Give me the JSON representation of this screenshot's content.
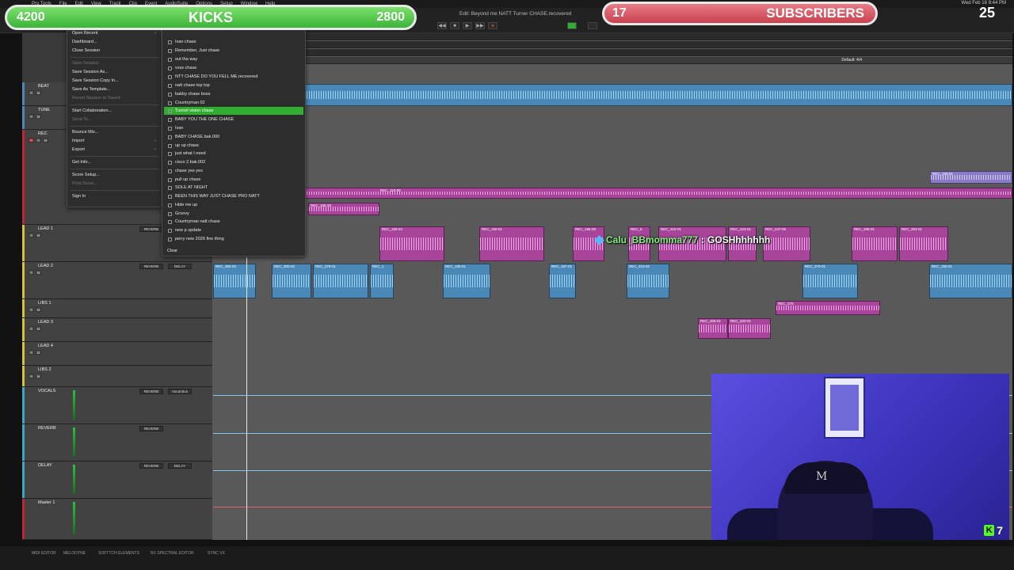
{
  "menubar": {
    "app": "Pro Tools",
    "items": [
      "File",
      "Edit",
      "View",
      "Track",
      "Clip",
      "Event",
      "AudioSuite",
      "Options",
      "Setup",
      "Window",
      "Help"
    ],
    "clock": "Wed Feb 18  9:44 PM"
  },
  "transport": {
    "session_title": "Edit: Beyond me NATT Turner CHASE.recovered"
  },
  "file_menu": {
    "items": [
      {
        "label": "Open Recent",
        "disabled": false,
        "submenu": true
      },
      {
        "label": "Dashboard...",
        "disabled": false
      },
      {
        "label": "Close Session",
        "disabled": false
      },
      {
        "label": "Save Session",
        "disabled": true
      },
      {
        "label": "Save Session As...",
        "disabled": false
      },
      {
        "label": "Save Session Copy In...",
        "disabled": false
      },
      {
        "label": "Save As Template...",
        "disabled": false
      },
      {
        "label": "Revert Session to Saved",
        "disabled": true
      },
      {
        "label": "Start Collaboration...",
        "disabled": false
      },
      {
        "label": "Send To...",
        "disabled": true
      },
      {
        "label": "Bounce Mix...",
        "disabled": false
      },
      {
        "label": "Import",
        "disabled": false,
        "submenu": true
      },
      {
        "label": "Export",
        "disabled": false,
        "submenu": true
      },
      {
        "label": "Get Info...",
        "disabled": false
      },
      {
        "label": "Score Setup...",
        "disabled": false
      },
      {
        "label": "Print Score...",
        "disabled": true
      },
      {
        "label": "Sign In",
        "disabled": false
      }
    ]
  },
  "recent_submenu": {
    "items": [
      "Ivan chase",
      "Remember, Just chase",
      "out tha way",
      "vvss chase",
      "NTT CHASE DO YOU FELL ME.recovered",
      "natt chase top top",
      "babby chase boss",
      "Countryman 02",
      "Tunnel vision chase",
      "BABY YOU THE ONE CHASE",
      "Ivan",
      "BABY CHASE.bak.000",
      "up up chase",
      "just what I need",
      "cisco 2.bak.002",
      "chase yes yes",
      "pull up chase",
      "SOLE AT NIGHT",
      "BEEN THIS WAY JUST CHASE PRO NATT",
      "Hide me up",
      "Groovy",
      "Countryman natt chase",
      "new p update",
      "perry new 2026 fine thing"
    ],
    "highlighted_index": 8,
    "clear_label": "Clear"
  },
  "tracks": [
    {
      "name": "BEAT",
      "color": "#4a88b8"
    },
    {
      "name": "TUNE",
      "color": "#4a88b8"
    },
    {
      "name": "REC",
      "color": "#c0263a"
    },
    {
      "name": "LEAD 1",
      "color": "#d6c23a",
      "plug1": "REVERB",
      "plug2": "DELAY"
    },
    {
      "name": "LEAD 2",
      "color": "#d6c23a",
      "plug1": "REVERB",
      "plug2": "DELAY"
    },
    {
      "name": "LIBS 1",
      "color": "#d6c23a",
      "plug1": "",
      "plug2": ""
    },
    {
      "name": "LEAD 3",
      "color": "#d6c23a",
      "plug1": "",
      "plug2": ""
    },
    {
      "name": "LEAD 4",
      "color": "#d6c23a",
      "plug1": "",
      "plug2": ""
    },
    {
      "name": "LIBS 2",
      "color": "#d6c23a",
      "plug1": "",
      "plug2": ""
    },
    {
      "name": "VOCALS",
      "color": "#3aa6c8",
      "plug1": "REVERB",
      "plug2": "Vocal Bus"
    },
    {
      "name": "REVERB",
      "color": "#3aa6c8",
      "plug1": "REVERB",
      "plug2": ""
    },
    {
      "name": "DELAY",
      "color": "#3aa6c8",
      "plug1": "REVERB",
      "plug2": "DELAY"
    },
    {
      "name": "Master 1",
      "color": "#c0263a",
      "plug1": "",
      "plug2": ""
    }
  ],
  "clips": {
    "beat_label": "Default: 4/4",
    "rec": [
      "REC_110-08",
      "REC_105-20",
      "REC_247-05",
      "REC_118-07",
      "REC_150-01",
      "REC_151-01"
    ],
    "lead1": [
      "REC_165-04",
      "REC_160-01",
      "REC_165-05",
      "REC_5",
      "REC_310-01",
      "REC_223-01",
      "REC_247-06",
      "REC_296-01",
      "REC_303-01"
    ],
    "lead2": [
      "REC_362-02",
      "REC_300-02",
      "REC_278-01",
      "REC_1",
      "REC_180-01",
      "REC_187-01",
      "REC_310-02",
      "REC_270-01",
      "REC_150-01"
    ],
    "libs1": [
      "REC_270"
    ],
    "lead3": [
      "REC_305-01",
      "REC_320-01"
    ]
  },
  "bottom_bar": [
    "MIDI EDITOR",
    "MELODYNE",
    "SOFTTCH ELEMENTS",
    "RX SPECTRAL EDITOR",
    "SYNC VX"
  ],
  "overlay": {
    "kicks_current": "4200",
    "kicks_label": "KICKS",
    "kicks_goal": "2800",
    "subs_current": "17",
    "subs_label": "SUBSCRIBERS",
    "subs_goal": "25",
    "chat_user": "Calu_BBmomma777",
    "chat_sep": ":",
    "chat_message": "GOSHhhhhhh",
    "cap_text": "M",
    "kick_badge_count": "7",
    "kick_badge_letter": "K"
  },
  "colors": {
    "kicks_green": "#3bb33a",
    "subs_red": "#c9414f",
    "highlight_green": "#2fae2f",
    "clip_blue": "#4a88b8",
    "clip_pink": "#a8459a"
  }
}
